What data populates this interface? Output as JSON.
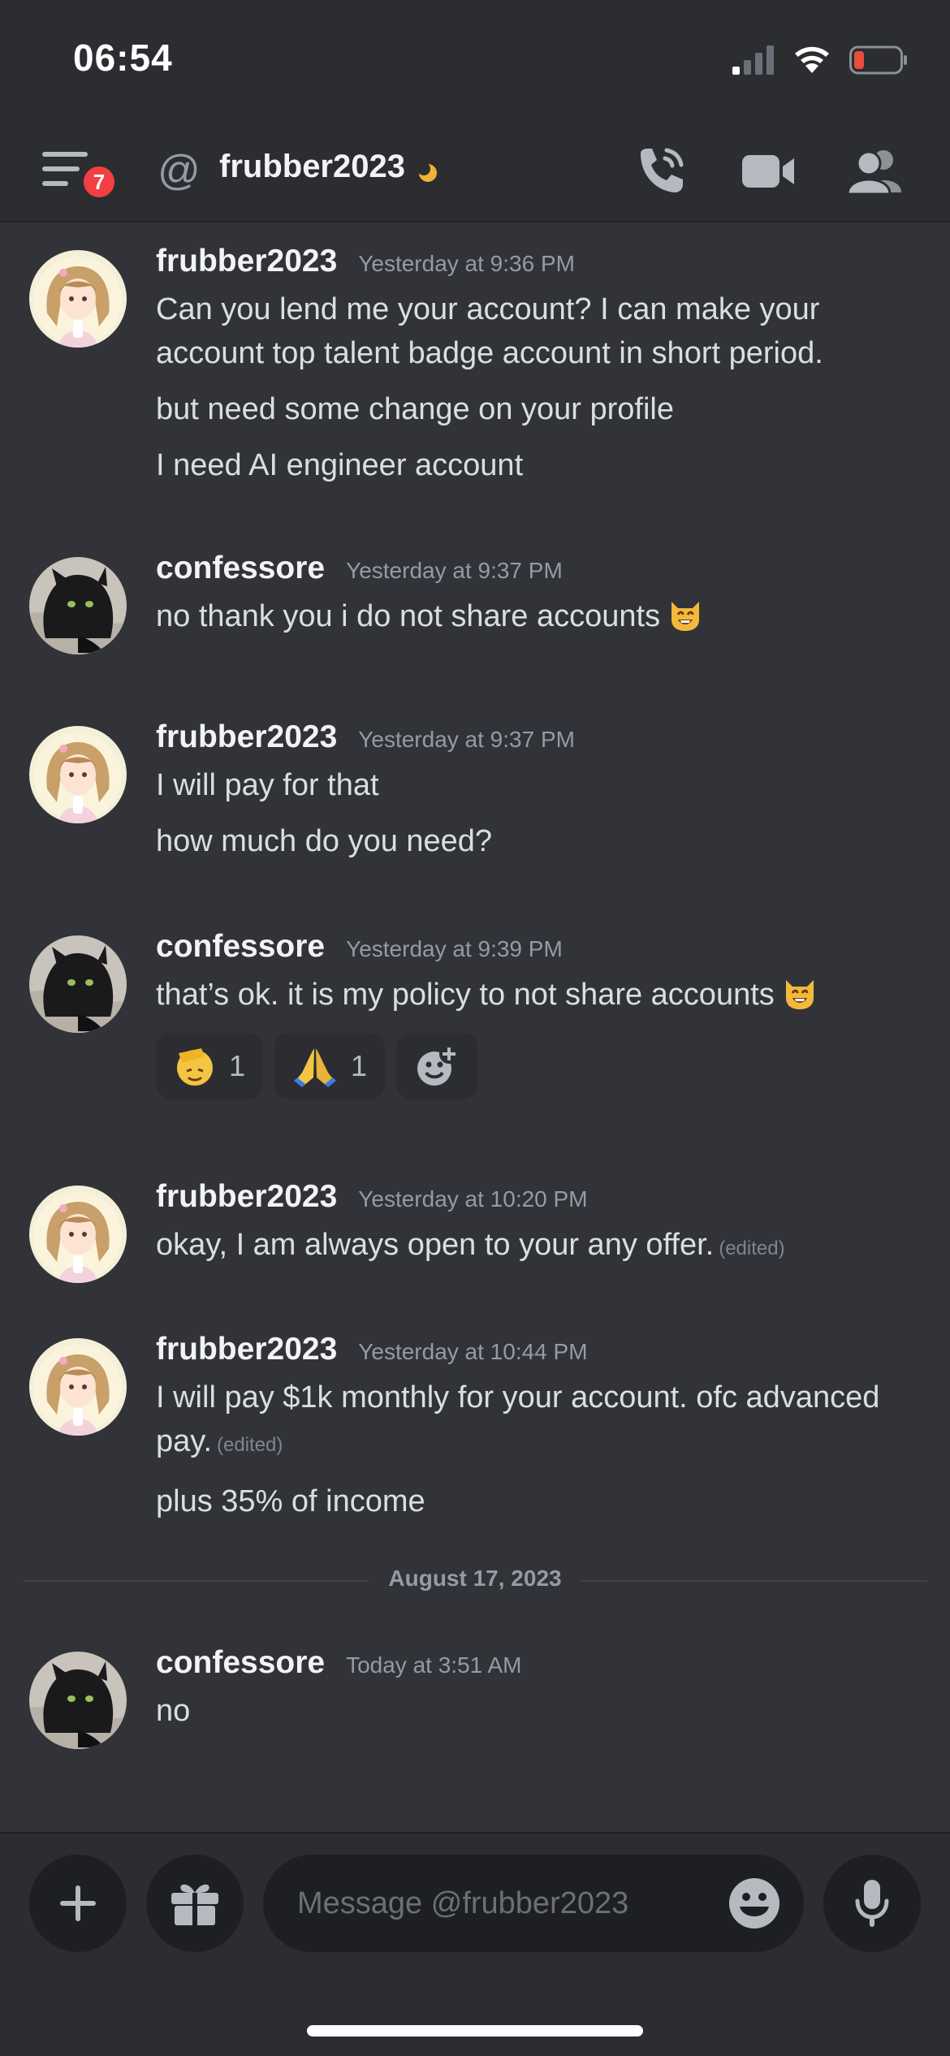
{
  "status_bar": {
    "time": "06:54",
    "icons": [
      "cellular-signal-icon",
      "wifi-icon",
      "battery-low-icon"
    ]
  },
  "header": {
    "notification_badge": "7",
    "channel_name": "frubber2023",
    "buttons": [
      "voice-call-icon",
      "video-call-icon",
      "members-icon"
    ]
  },
  "messages": [
    {
      "author": "frubber2023",
      "time": "Yesterday at 9:36 PM",
      "avatar": "anime-girl-avatar",
      "lines": [
        "Can you lend me your account? I can make your account top talent badge account in short period.",
        "but need some change on your profile",
        "I need AI engineer account"
      ]
    },
    {
      "author": "confessore",
      "time": "Yesterday at 9:37 PM",
      "avatar": "black-cat-avatar",
      "lines": [
        "no thank you i do not share accounts"
      ],
      "trailing_emoji": "smiling-cat-emoji"
    },
    {
      "author": "frubber2023",
      "time": "Yesterday at 9:37 PM",
      "avatar": "anime-girl-avatar",
      "lines": [
        "I will pay for that",
        "how much do you need?"
      ]
    },
    {
      "author": "confessore",
      "time": "Yesterday at 9:39 PM",
      "avatar": "black-cat-avatar",
      "lines": [
        "that’s ok. it is my policy to not share accounts"
      ],
      "trailing_emoji": "smiling-cat-emoji",
      "reactions": [
        {
          "emoji": "saluting-face-emoji",
          "count": "1"
        },
        {
          "emoji": "folded-hands-emoji",
          "count": "1"
        }
      ],
      "add_reaction": "add-reaction-icon"
    },
    {
      "author": "frubber2023",
      "time": "Yesterday at 10:20 PM",
      "avatar": "anime-girl-avatar",
      "lines": [
        "okay, I am always open to your any offer."
      ],
      "edited_label": "(edited)"
    },
    {
      "author": "frubber2023",
      "time": "Yesterday at 10:44 PM",
      "avatar": "anime-girl-avatar",
      "lines": [
        "I will pay $1k monthly for your account. ofc advanced pay.",
        "plus 35% of income"
      ],
      "edited_label": "(edited)"
    },
    {
      "author": "confessore",
      "time": "Today at 3:51 AM",
      "avatar": "black-cat-avatar",
      "lines": [
        "no"
      ]
    }
  ],
  "date_divider": "August 17, 2023",
  "composer": {
    "placeholder": "Message @frubber2023",
    "buttons": [
      "plus-icon",
      "gift-icon",
      "emoji-icon",
      "microphone-icon"
    ]
  },
  "colors": {
    "background": "#313338",
    "header_background": "#2b2d31",
    "input_background": "#1e1f22",
    "badge_red": "#f23f42",
    "idle_yellow": "#f0b232",
    "muted_text": "#949ba4"
  }
}
